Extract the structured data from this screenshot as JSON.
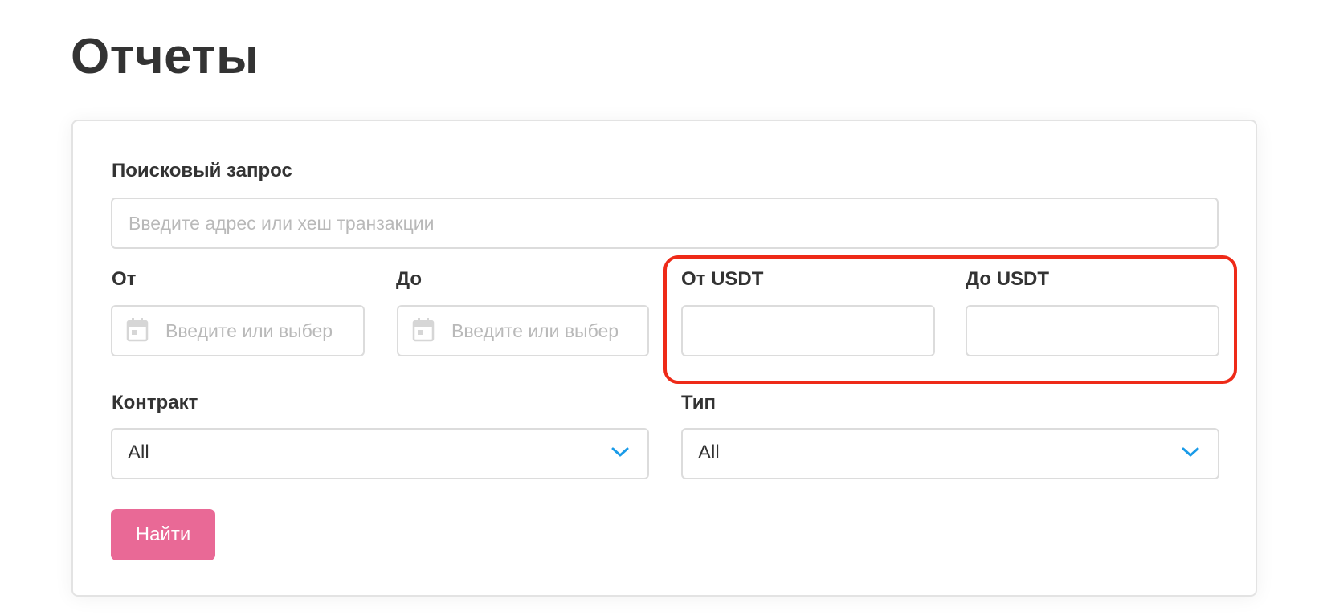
{
  "page": {
    "title": "Отчеты"
  },
  "form": {
    "search": {
      "label": "Поисковый запрос",
      "placeholder": "Введите адрес или хеш транзакции",
      "value": ""
    },
    "date_from": {
      "label": "От",
      "placeholder": "Введите или выбер",
      "icon": "calendar-icon"
    },
    "date_to": {
      "label": "До",
      "placeholder": "Введите или выбер",
      "icon": "calendar-icon"
    },
    "usdt_from": {
      "label": "От USDT",
      "value": ""
    },
    "usdt_to": {
      "label": "До USDT",
      "value": ""
    },
    "contract": {
      "label": "Контракт",
      "selected": "All",
      "icon": "chevron-down-icon"
    },
    "type": {
      "label": "Тип",
      "selected": "All",
      "icon": "chevron-down-icon"
    },
    "submit_label": "Найти"
  },
  "colors": {
    "button_bg": "#e96996",
    "chevron": "#1a9be8",
    "highlight": "#ee2a18",
    "title": "#333333",
    "border": "#dcdcdc"
  }
}
